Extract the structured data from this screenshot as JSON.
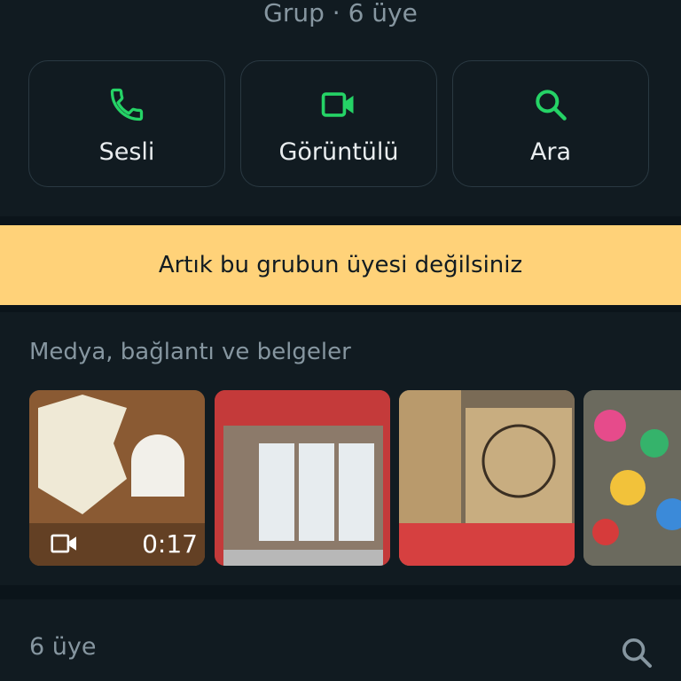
{
  "header": {
    "subtitle": "Grup · 6 üye"
  },
  "actions": [
    {
      "label": "Sesli",
      "icon": "phone-icon"
    },
    {
      "label": "Görüntülü",
      "icon": "video-icon"
    },
    {
      "label": "Ara",
      "icon": "search-icon"
    }
  ],
  "banner": {
    "text": "Artık bu grubun üyesi değilsiniz"
  },
  "media": {
    "title": "Medya, bağlantı ve belgeler",
    "items": [
      {
        "type": "video",
        "duration": "0:17"
      },
      {
        "type": "image"
      },
      {
        "type": "image"
      },
      {
        "type": "image"
      }
    ]
  },
  "members": {
    "title": "6 üye"
  },
  "colors": {
    "accent": "#25d366",
    "banner": "#ffd279",
    "background": "#111b21"
  }
}
